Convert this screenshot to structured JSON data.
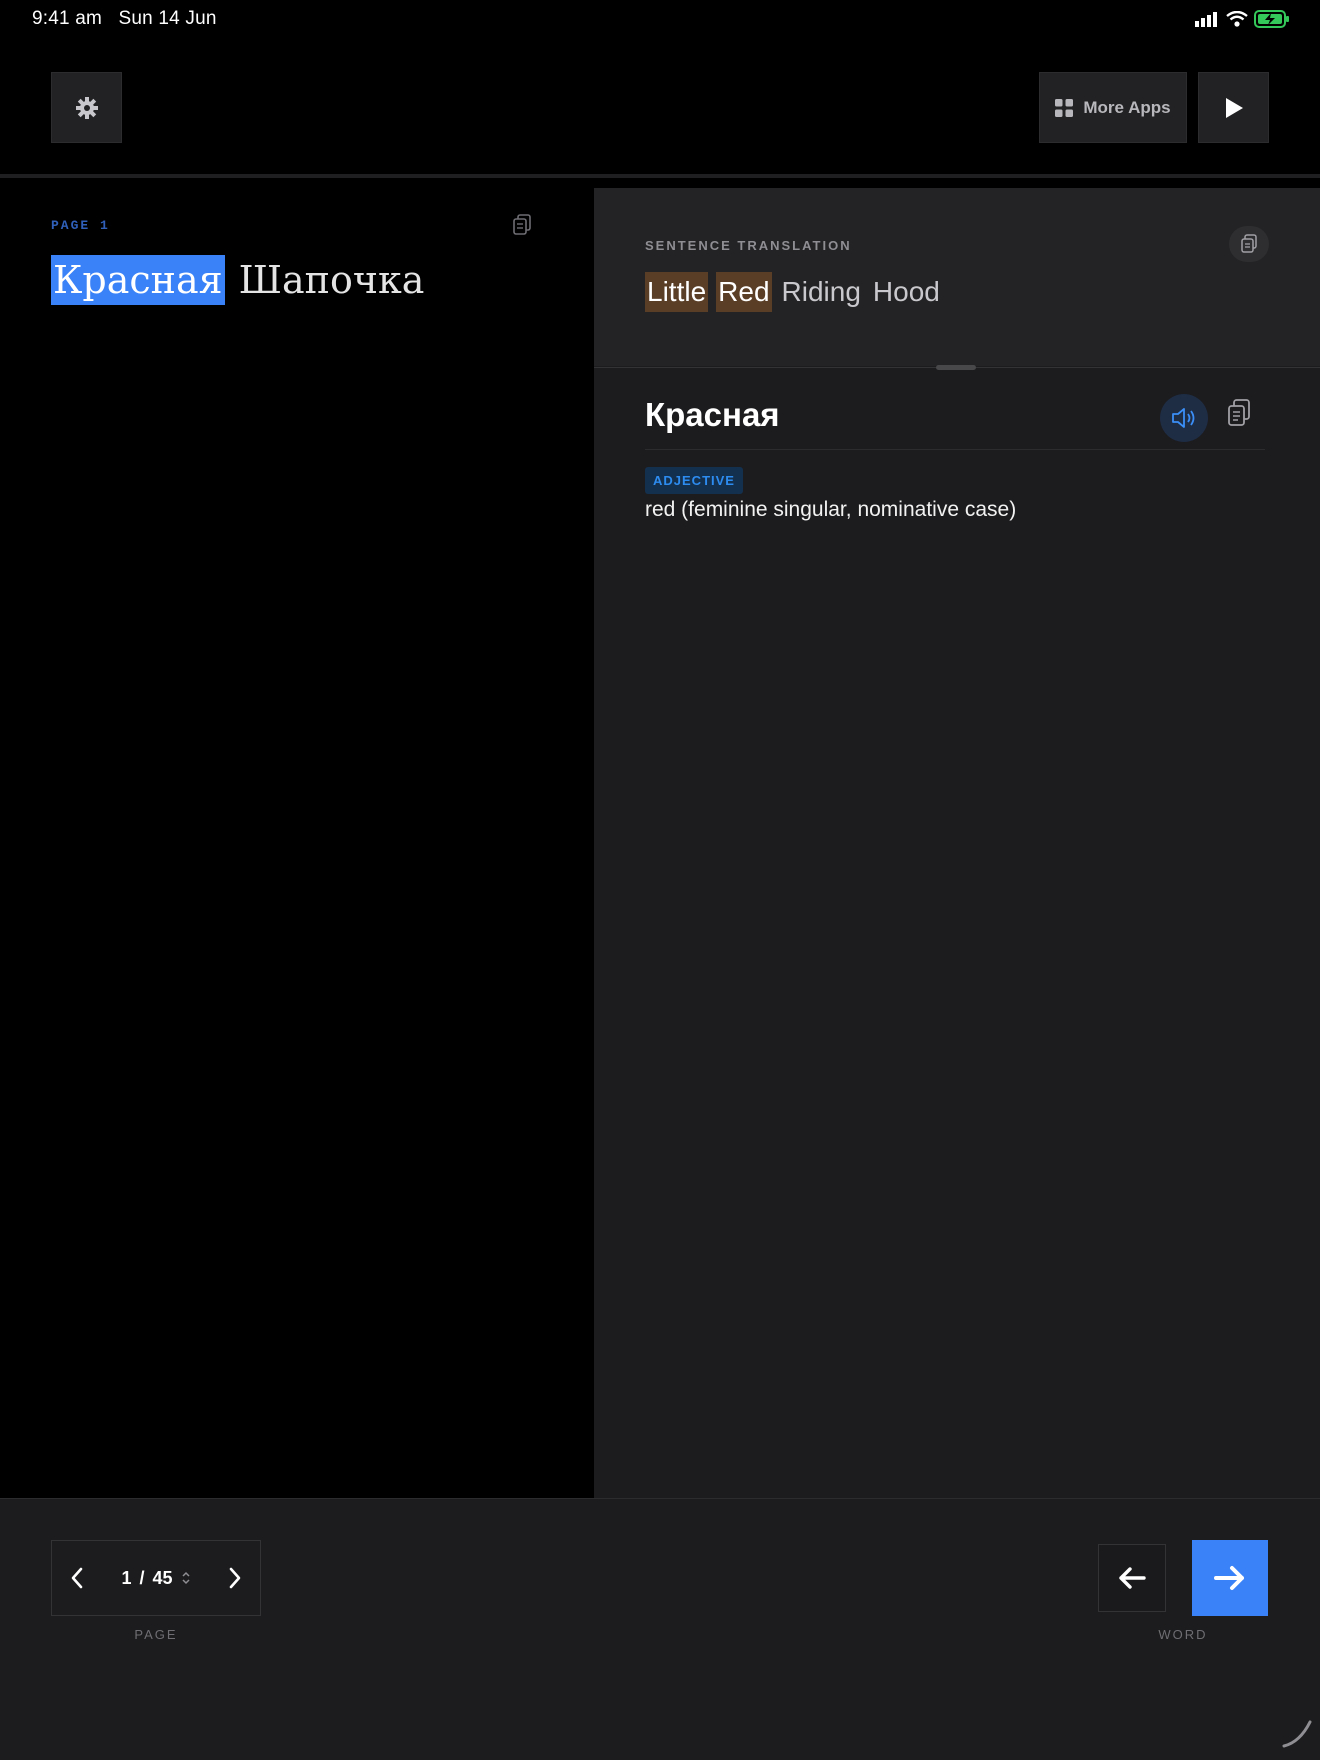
{
  "status_bar": {
    "time": "9:41 am",
    "date": "Sun 14 Jun",
    "signal_icon": "cellular-signal-icon",
    "wifi_icon": "wifi-icon",
    "battery_icon": "battery-charging-icon"
  },
  "toolbar": {
    "settings_icon": "gear-icon",
    "more_apps_label": "More Apps",
    "more_apps_icon": "grid-icon",
    "play_icon": "play-icon"
  },
  "source": {
    "page_label": "PAGE 1",
    "words": [
      {
        "text": "Красная",
        "selected": true
      },
      {
        "text": "Шапочка",
        "selected": false
      }
    ]
  },
  "translation": {
    "label": "SENTENCE TRANSLATION",
    "words": [
      {
        "text": "Little",
        "highlighted": true
      },
      {
        "text": "Red",
        "highlighted": true
      },
      {
        "text": "Riding",
        "highlighted": false
      },
      {
        "text": "Hood",
        "highlighted": false
      }
    ]
  },
  "word_detail": {
    "word": "Красная",
    "part_of_speech": "ADJECTIVE",
    "definition": "red (feminine singular, nominative case)"
  },
  "pager": {
    "current": "1",
    "separator": "/",
    "total": "45",
    "caption": "PAGE"
  },
  "word_nav": {
    "caption": "WORD"
  },
  "colors": {
    "accent": "#3a82f7",
    "highlight": "#5a3e26",
    "panel": "#1c1c1e",
    "badge_text": "#2d8cf0"
  }
}
